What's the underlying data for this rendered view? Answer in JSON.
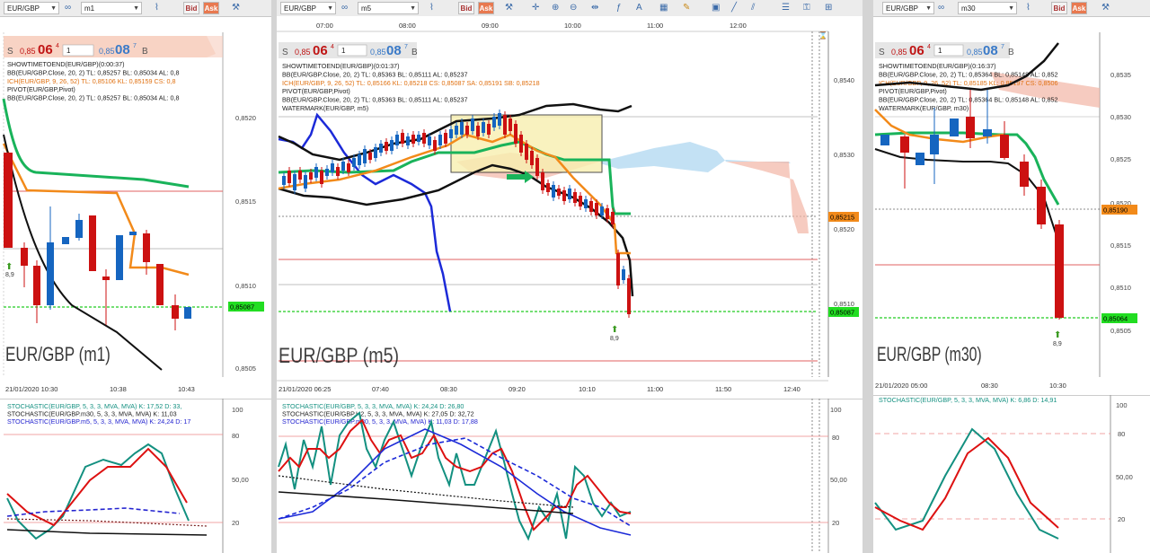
{
  "colors": {
    "bull": "#1565c0",
    "bear": "#cc1111",
    "bb": "#111111",
    "ichimoku": "#f28a1a",
    "kijun": "#19b35a",
    "tenkan": "#2424d0",
    "level_green": "#22cc22",
    "ask": "#e87950"
  },
  "windows": [
    {
      "id": "m1",
      "symbol": "EUR/GBP",
      "timeframe": "m1",
      "bid_label": "Bid",
      "ask_label": "Ask",
      "quote": {
        "s": "S",
        "sell_small": "0,85",
        "sell_big": "06",
        "sell_sup": "4",
        "lot": "1",
        "buy_small": "0,85",
        "buy_big": "08",
        "buy_sup": "7",
        "b": "B"
      },
      "indicators": [
        {
          "text": "SHOWTIMETOEND(EUR/GBP)(0:00:37)",
          "color": "#222"
        },
        {
          "text": "BB(EUR/GBP.Close, 20, 2)   TL: 0,85257  BL: 0,85034  AL: 0,8",
          "color": "#222"
        },
        {
          "text": "ICH(EUR/GBP, 9, 26, 52)   TL: 0,85106  KL: 0,85159  CS: 0,8",
          "color": "#e07010"
        },
        {
          "text": "PIVOT(EUR/GBP,Pivot)",
          "color": "#222"
        },
        {
          "text": "BB(EUR/GBP.Close, 20, 2)   TL: 0,85257  BL: 0,85034  AL: 0,8",
          "color": "#222"
        }
      ],
      "watermark": "EUR/GBP (m1)",
      "price_axis": [
        "0,8520",
        "0,8515",
        "0,8510",
        "0,8505"
      ],
      "price_marker": "0,85087",
      "arrow_label": "8,9",
      "time_axis": [
        "21/01/2020 10:30",
        "10:38",
        "10:43"
      ],
      "stochastic": [
        {
          "text": "STOCHASTIC(EUR/GBP, 5, 3, 3, MVA, MVA)   K: 17,52  D: 33,",
          "color": "#139080"
        },
        {
          "text": "STOCHASTIC(EUR/GBP.m30, 5, 3, 3, MVA, MVA)   K: 11,03",
          "color": "#222"
        },
        {
          "text": "STOCHASTIC(EUR/GBP.m5, 5, 3, 3, MVA, MVA)   K: 24,24  D: 17",
          "color": "#2424d0"
        }
      ],
      "stoch_axis": [
        "100",
        "80",
        "50,00",
        "20",
        "0"
      ]
    },
    {
      "id": "m5",
      "symbol": "EUR/GBP",
      "timeframe": "m5",
      "bid_label": "Bid",
      "ask_label": "Ask",
      "quote": {
        "s": "S",
        "sell_small": "0,85",
        "sell_big": "06",
        "sell_sup": "4",
        "lot": "1",
        "buy_small": "0,85",
        "buy_big": "08",
        "buy_sup": "7",
        "b": "B"
      },
      "top_times": [
        "07:00",
        "08:00",
        "09:00",
        "10:00",
        "11:00",
        "12:00"
      ],
      "indicators": [
        {
          "text": "SHOWTIMETOEND(EUR/GBP)(0:01:37)",
          "color": "#222"
        },
        {
          "text": "BB(EUR/GBP.Close, 20, 2)   TL: 0,85363  BL: 0,85111  AL: 0,85237",
          "color": "#222"
        },
        {
          "text": "ICH(EUR/GBP, 9, 26, 52)   TL: 0,85166  KL: 0,85218  CS: 0,85087  SA: 0,85191  SB: 0,85218",
          "color": "#e07010"
        },
        {
          "text": "PIVOT(EUR/GBP,Pivot)",
          "color": "#222"
        },
        {
          "text": "BB(EUR/GBP.Close, 20, 2)   TL: 0,85363  BL: 0,85111  AL: 0,85237",
          "color": "#222"
        },
        {
          "text": "WATERMARK(EUR/GBP, m5)",
          "color": "#222"
        }
      ],
      "watermark": "EUR/GBP (m5)",
      "price_axis": [
        "0,8540",
        "0,8530",
        "0,8520",
        "0,8510"
      ],
      "price_marker_top": "0,85215",
      "price_marker": "0,85087",
      "arrow_label": "8,9",
      "time_axis": [
        "21/01/2020 06:25",
        "07:40",
        "08:30",
        "09:20",
        "10:10",
        "11:00",
        "11:50",
        "12:40"
      ],
      "stochastic": [
        {
          "text": "STOCHASTIC(EUR/GBP, 5, 3, 3, MVA, MVA)   K: 24,24  D: 26,80",
          "color": "#139080"
        },
        {
          "text": "STOCHASTIC(EUR/GBP.H2, 5, 3, 3, MVA, MVA)   K: 27,05  D: 32,72",
          "color": "#222"
        },
        {
          "text": "STOCHASTIC(EUR/GBP.m30, 5, 3, 3, MVA, MVA)   K: 11,03  D: 17,88",
          "color": "#2424d0"
        }
      ],
      "stoch_axis": [
        "100",
        "80",
        "50,00",
        "20",
        "0"
      ]
    },
    {
      "id": "m30",
      "symbol": "EUR/GBP",
      "timeframe": "m30",
      "bid_label": "Bid",
      "ask_label": "Ask",
      "quote": {
        "s": "S",
        "sell_small": "0,85",
        "sell_big": "06",
        "sell_sup": "4",
        "lot": "1",
        "buy_small": "0,85",
        "buy_big": "08",
        "buy_sup": "7",
        "b": "B"
      },
      "indicators": [
        {
          "text": "SHOWTIMETOEND(EUR/GBP)(0:16:37)",
          "color": "#222"
        },
        {
          "text": "BB(EUR/GBP.Close, 20, 2)   TL: 0,85364  BL: 0,85148  AL: 0,852",
          "color": "#222"
        },
        {
          "text": "ICH(EUR/GBP, 9, 26, 52)   TL: 0,85185  KL: 0,85197  CS: 0,8506",
          "color": "#e07010"
        },
        {
          "text": "PIVOT(EUR/GBP,Pivot)",
          "color": "#222"
        },
        {
          "text": "BB(EUR/GBP.Close, 20, 2)   TL: 0,85364  BL: 0,85148  AL: 0,852",
          "color": "#222"
        },
        {
          "text": "WATERMARK(EUR/GBP, m30)",
          "color": "#222"
        }
      ],
      "watermark": "EUR/GBP (m30)",
      "price_axis": [
        "0,8535",
        "0,8530",
        "0,8525",
        "0,8520",
        "0,8515",
        "0,8510",
        "0,8505"
      ],
      "price_marker_top": "0,85190",
      "price_marker": "0,85064",
      "arrow_label": "8,9",
      "time_axis": [
        "21/01/2020 05:00",
        "08:30",
        "10:30"
      ],
      "stochastic": [
        {
          "text": "STOCHASTIC(EUR/GBP, 5, 3, 3, MVA, MVA)   K: 6,86  D: 14,91",
          "color": "#139080"
        }
      ],
      "stoch_axis": [
        "100",
        "80",
        "50,00",
        "20",
        "0"
      ]
    }
  ]
}
